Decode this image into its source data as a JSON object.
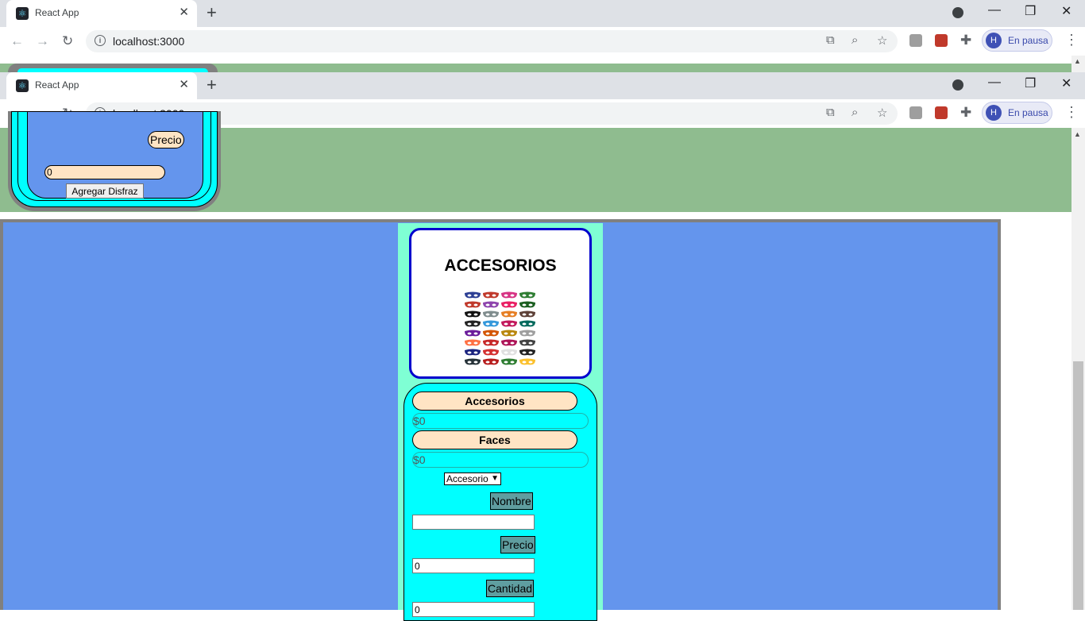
{
  "browser_back": {
    "tab_title": "React App",
    "url": "localhost:3000",
    "profile_initial": "H",
    "profile_label": "En pausa"
  },
  "browser_front": {
    "tab_title": "React App",
    "url": "localhost:3000",
    "profile_initial": "H",
    "profile_label": "En pausa"
  },
  "top_form": {
    "precio_label": "Precio",
    "precio_value": "0",
    "add_button": "Agregar Disfraz"
  },
  "card": {
    "title": "ACCESORIOS"
  },
  "panel": {
    "category_label": "Accesorios",
    "category_total": "$0",
    "subcategory_label": "Faces",
    "subcategory_total": "$0",
    "type_select": "Accesorio",
    "nombre_label": "Nombre",
    "nombre_value": "",
    "precio_label": "Precio",
    "precio_value": "0",
    "cantidad_label": "Cantidad",
    "cantidad_value": "0"
  },
  "mask_colors": [
    "#2c3e94",
    "#c0392b",
    "#d63384",
    "#2e7d32",
    "#c0392b",
    "#8e44ad",
    "#e91e63",
    "#1b5e20",
    "#111111",
    "#7f8c8d",
    "#e67e22",
    "#5d4037",
    "#222222",
    "#3498db",
    "#c2185b",
    "#00695c",
    "#6a1b9a",
    "#d35400",
    "#b8860b",
    "#9e9e9e",
    "#ff7043",
    "#c62828",
    "#ad1457",
    "#424242",
    "#1a237e",
    "#d32f2f",
    "#e0e0e0",
    "#212121",
    "#263238",
    "#b71c1c",
    "#2e7d32",
    "#fbc02d"
  ]
}
